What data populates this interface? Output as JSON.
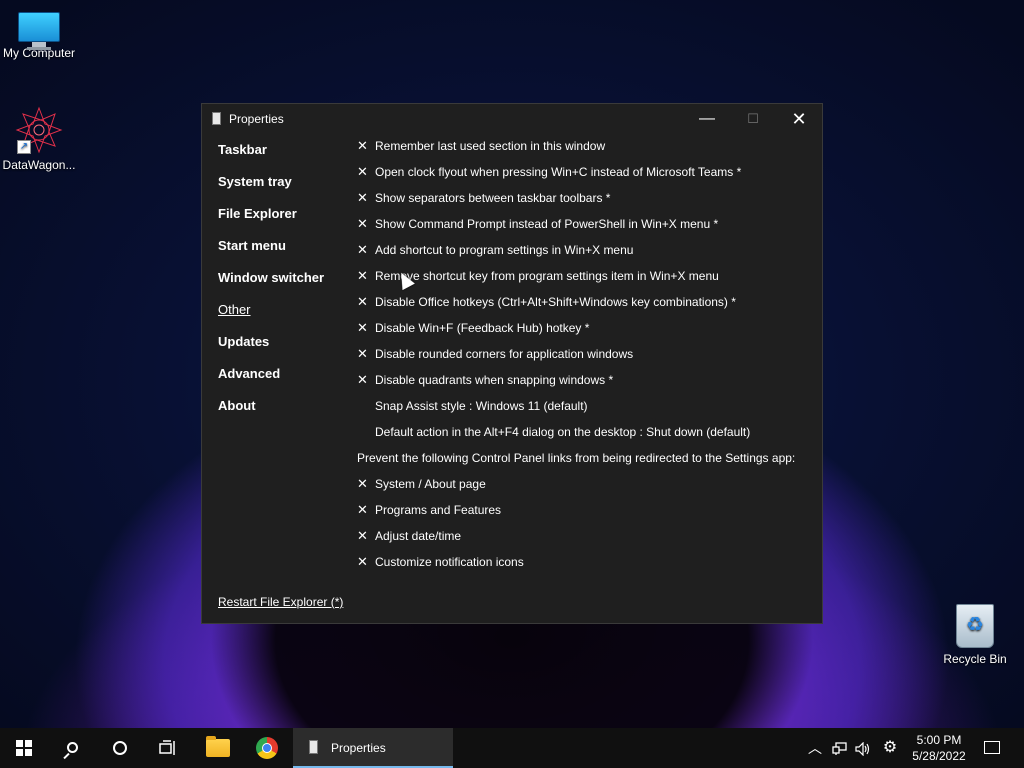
{
  "desktop": {
    "icons": [
      {
        "label": "My Computer"
      },
      {
        "label": "DataWagon..."
      },
      {
        "label": "Recycle Bin"
      }
    ]
  },
  "window": {
    "title": "Properties",
    "controls": {
      "minimize": "—",
      "maximize": "☐",
      "close": "✕"
    },
    "sidebar": {
      "items": [
        {
          "label": "Taskbar"
        },
        {
          "label": "System tray"
        },
        {
          "label": "File Explorer"
        },
        {
          "label": "Start menu"
        },
        {
          "label": "Window switcher"
        },
        {
          "label": "Other"
        },
        {
          "label": "Updates"
        },
        {
          "label": "Advanced"
        },
        {
          "label": "About"
        }
      ],
      "active": "Other"
    },
    "settings": [
      {
        "mark": "✕",
        "label": "Remember last used section in this window"
      },
      {
        "mark": "✕",
        "label": "Open clock flyout when pressing Win+C instead of Microsoft Teams *"
      },
      {
        "mark": "✕",
        "label": "Show separators between taskbar toolbars *"
      },
      {
        "mark": "✕",
        "label": "Show Command Prompt instead of PowerShell in Win+X menu *"
      },
      {
        "mark": "✕",
        "label": "Add shortcut to program settings in Win+X menu"
      },
      {
        "mark": "✕",
        "label": "Remove shortcut key from program settings item in Win+X menu"
      },
      {
        "mark": "✕",
        "label": "Disable Office hotkeys (Ctrl+Alt+Shift+Windows key combinations) *"
      },
      {
        "mark": "✕",
        "label": "Disable Win+F (Feedback Hub) hotkey *"
      },
      {
        "mark": "✕",
        "label": "Disable rounded corners for application windows"
      },
      {
        "mark": "✕",
        "label": "Disable quadrants when snapping windows *"
      },
      {
        "mark": "",
        "label": "Snap Assist style : Windows 11 (default)"
      },
      {
        "mark": "",
        "label": "Default action in the Alt+F4 dialog on the desktop : Shut down (default)"
      }
    ],
    "section_heading": "Prevent the following Control Panel links from being redirected to the Settings app:",
    "redirect_settings": [
      {
        "mark": "✕",
        "label": "System / About page"
      },
      {
        "mark": "✕",
        "label": "Programs and Features"
      },
      {
        "mark": "✕",
        "label": "Adjust date/time"
      },
      {
        "mark": "✕",
        "label": "Customize notification icons"
      }
    ],
    "restart_link": "Restart File Explorer (*)"
  },
  "taskbar": {
    "task_label": "Properties",
    "clock_time": "5:00 PM",
    "clock_date": "5/28/2022",
    "tray_icons": [
      "chevron-up-icon",
      "network-icon",
      "volume-icon",
      "gear-icon"
    ],
    "glyphs": {
      "chevron": "︿",
      "network": "🖧",
      "volume": "🔈",
      "gear": "⚙"
    }
  }
}
